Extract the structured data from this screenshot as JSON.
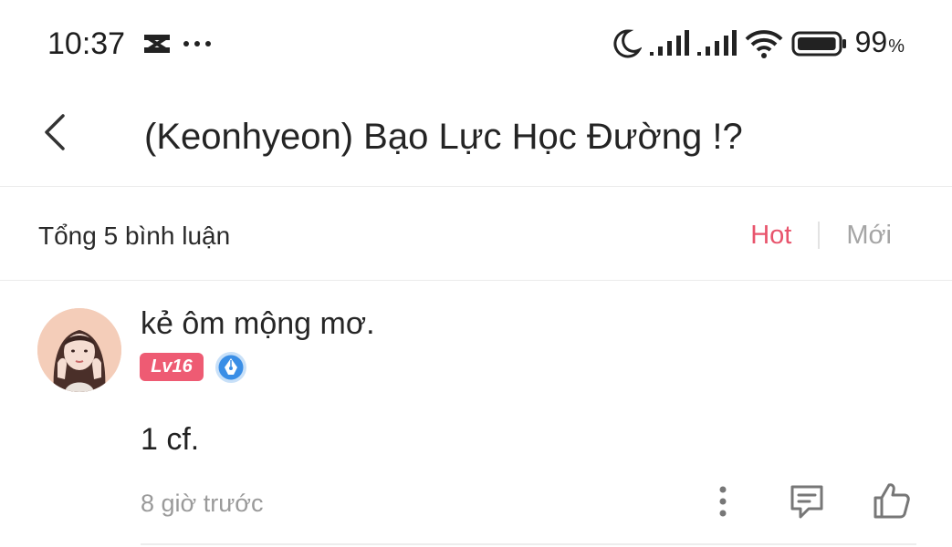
{
  "status_bar": {
    "time": "10:37",
    "left_icons": [
      "capcut-icon",
      "more-dots-icon"
    ],
    "right_icons": [
      "moon-icon",
      "signal-1-icon",
      "signal-2-icon",
      "wifi-icon",
      "battery-icon"
    ],
    "battery_number": "99",
    "battery_unit": "%",
    "battery_level": 0.99
  },
  "header": {
    "back_icon": "chevron-left-icon",
    "title": "(Keonhyeon) Bạo Lực Học Đường !?"
  },
  "comments_bar": {
    "total_label": "Tổng 5 bình luận",
    "sort_options": [
      "Hot",
      "Mới"
    ],
    "active_sort": "Hot"
  },
  "comment": {
    "username": "kẻ ôm mộng mơ.",
    "level_badge": "Lv16",
    "role_icon": "pen-nib-badge-icon",
    "text": "1 cf.",
    "timestamp": "8 giờ trước",
    "actions": [
      "more-vertical-icon",
      "reply-comment-icon",
      "thumbs-up-icon"
    ]
  },
  "colors": {
    "accent": "#e8546c",
    "badge": "#ee5b73",
    "badge_blue": "#3a8ee6",
    "muted": "#a5a5a5"
  }
}
